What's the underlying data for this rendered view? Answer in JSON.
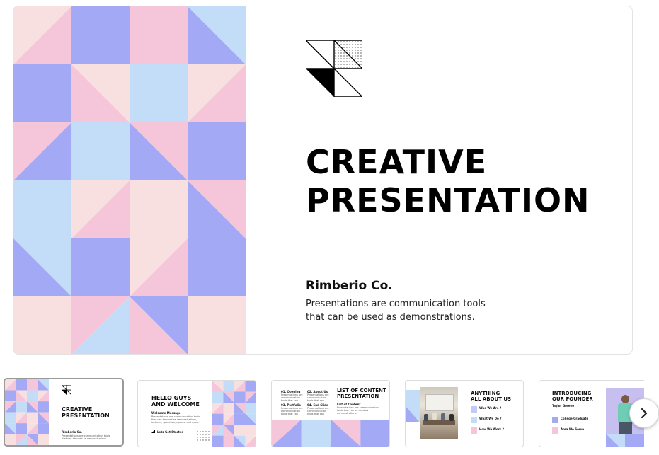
{
  "slide": {
    "title_line1": "CREATIVE",
    "title_line2": "PRESENTATION",
    "company": "Rimberio Co.",
    "description": "Presentations are communication tools that can be used as demonstrations."
  },
  "colors": {
    "pink": "#f5c5d9",
    "periwinkle": "#a3a9f4",
    "light_blue": "#c3dcf7",
    "blush": "#f8e0e1"
  },
  "thumbnails": [
    {
      "title_line1": "CREATIVE",
      "title_line2": "PRESENTATION",
      "company": "Rimberio Co.",
      "text": "Presentations are communication tools that can be used as demonstrations.",
      "selected": true
    },
    {
      "title_line1": "HELLO GUYS",
      "title_line2": "AND WELCOME",
      "subtitle": "Welcome Message",
      "text": "Presentations are communication tools that can be used as demonstrations, lectures, speeches, reports, and more.",
      "cta": "Lets Get Started"
    },
    {
      "title_line1": "LIST OF CONTENT",
      "title_line2": "PRESENTATION",
      "items": [
        "01. Opening",
        "02. About Us",
        "03. Portfolio",
        "04. End Slide"
      ],
      "subtitle": "List of Content"
    },
    {
      "title_line1": "ANYTHING",
      "title_line2": "ALL ABOUT US",
      "items": [
        "Who We Are ?",
        "What We Do ?",
        "How We Work ?"
      ]
    },
    {
      "title_line1": "INTRODUCING",
      "title_line2": "OUR FOUNDER",
      "subtitle": "Taylor Greene",
      "items": [
        "College Graduate",
        "Area We Serve"
      ]
    }
  ],
  "icons": {
    "next": "chevron-right-icon",
    "logo": "triangle-grid-logo-icon"
  }
}
